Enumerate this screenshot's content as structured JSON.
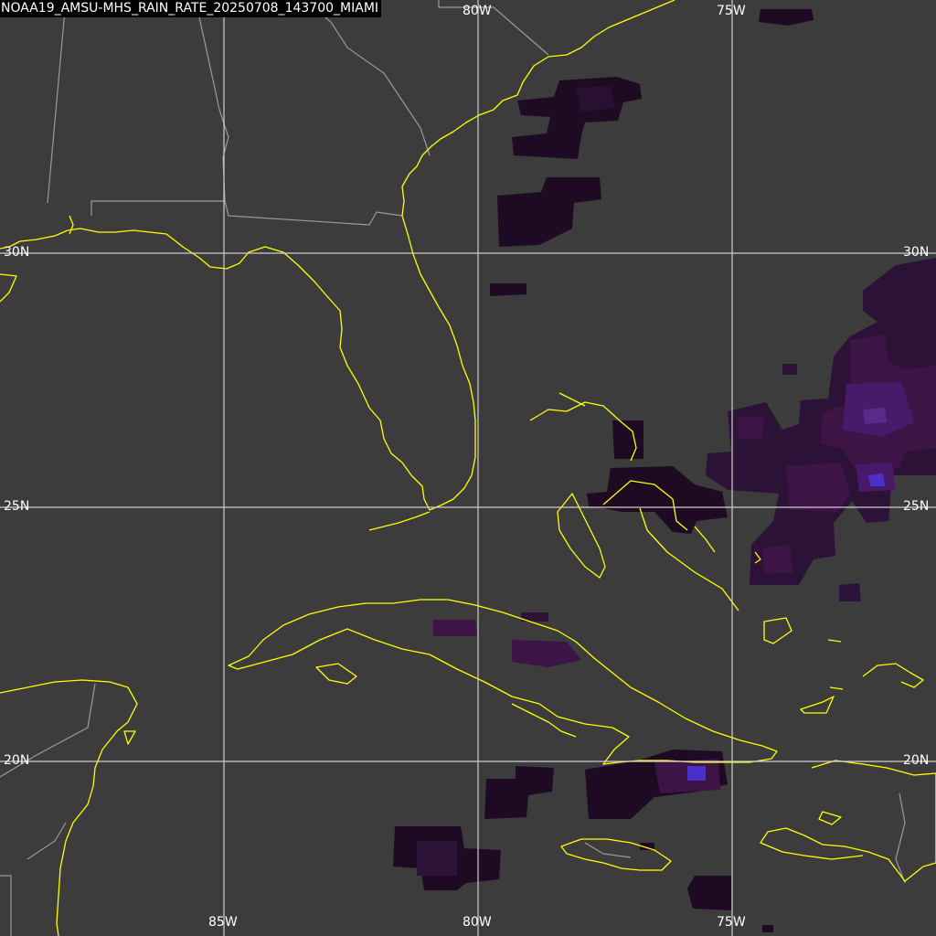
{
  "product": {
    "title": "NOAA19_AMSU-MHS_RAIN_RATE_20250708_143700_MIAMI"
  },
  "map": {
    "background_color": "#3c3c3c",
    "coastline_color": "#ffff00",
    "border_color": "#9a9a9a",
    "gridline_color": "#cfcfcf",
    "rain_rate_colors": [
      "#1e0a23",
      "#3c1446",
      "#5a2a8c",
      "#4a30c8"
    ],
    "longitude_labels": {
      "top": [
        "80W",
        "75W"
      ],
      "bottom": [
        "85W",
        "80W",
        "75W"
      ]
    },
    "latitude_labels": {
      "left": [
        "30N",
        "25N",
        "20N"
      ],
      "right": [
        "30N",
        "25N",
        "20N"
      ]
    }
  }
}
